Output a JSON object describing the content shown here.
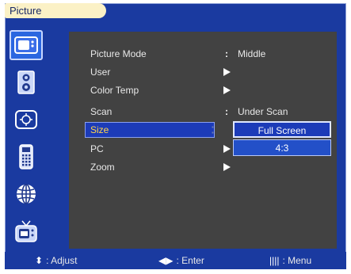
{
  "title": "Picture",
  "sidebar": {
    "items": [
      {
        "icon": "picture-icon",
        "active": true
      },
      {
        "icon": "speaker-icon",
        "active": false
      },
      {
        "icon": "settings-knob-icon",
        "active": false
      },
      {
        "icon": "remote-icon",
        "active": false
      },
      {
        "icon": "globe-icon",
        "active": false
      },
      {
        "icon": "tv-icon",
        "active": false
      }
    ]
  },
  "menu": {
    "rows": [
      {
        "label": "Picture Mode",
        "mark": ":",
        "value": "Middle"
      },
      {
        "label": "User",
        "mark": "arrow",
        "value": ""
      },
      {
        "label": "Color Temp",
        "mark": "arrow",
        "value": ""
      },
      {
        "label": "Scan",
        "mark": ":",
        "value": "Under Scan"
      },
      {
        "label": "Size",
        "mark": "",
        "value": "",
        "selected": true
      },
      {
        "label": "PC",
        "mark": "arrow",
        "value": ""
      },
      {
        "label": "Zoom",
        "mark": "arrow",
        "value": ""
      }
    ]
  },
  "size_dropdown": {
    "options": [
      "Full Screen",
      "4:3"
    ],
    "selected": "Full Screen"
  },
  "footer": {
    "adjust": ": Adjust",
    "enter": ": Enter",
    "menu": ": Menu"
  }
}
